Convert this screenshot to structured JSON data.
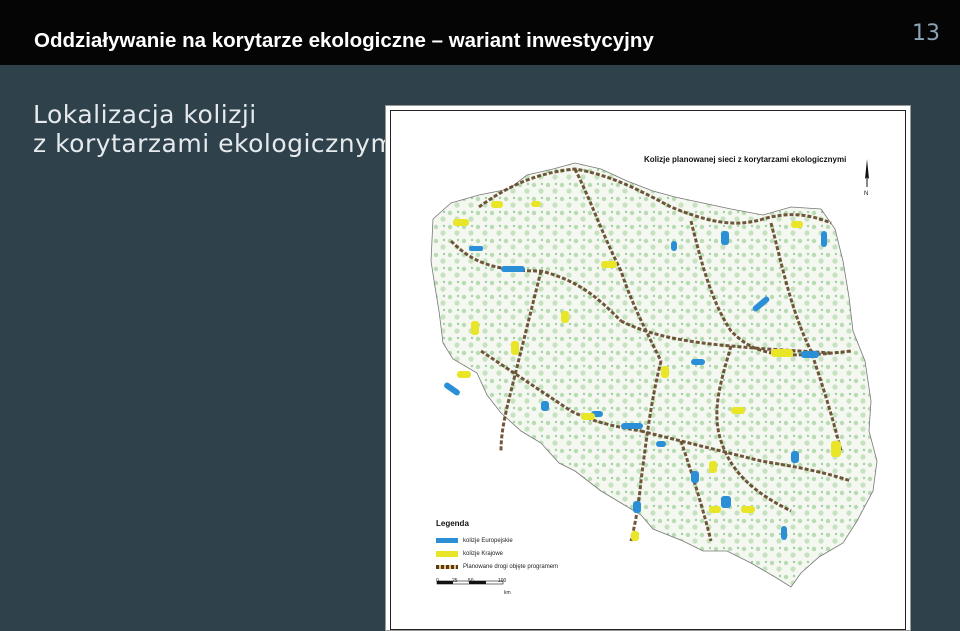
{
  "header": {
    "title": "Oddziaływanie na korytarze ekologiczne – wariant inwestycyjny",
    "page_number": "13"
  },
  "subtitle": {
    "line1": "Lokalizacja kolizji",
    "line2": "z korytarzami ekologicznymi"
  },
  "map": {
    "title": "Kolizje planowanej sieci z korytarzami ekologicznymi",
    "legend": {
      "title": "Legenda",
      "items": [
        {
          "label": "kolizje Europejskie",
          "color": "#2a8fd6"
        },
        {
          "label": "kolizje Krajowe",
          "color": "#e9e527"
        },
        {
          "label": "Planowane drogi objęte programem",
          "color": "#5a3a1c"
        }
      ],
      "scale_ticks": [
        "0",
        "25",
        "50",
        "100"
      ],
      "scale_unit": "km"
    },
    "north_label": "N"
  }
}
